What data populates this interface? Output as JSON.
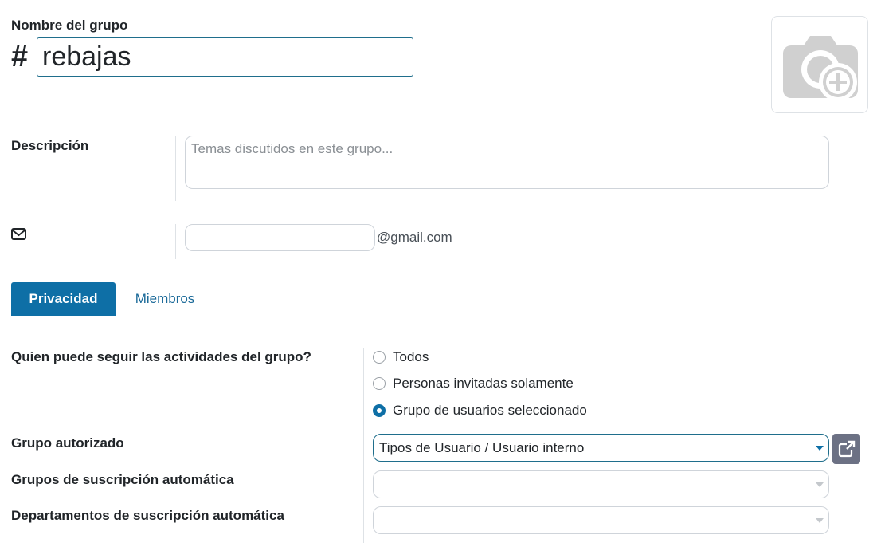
{
  "form": {
    "name_label": "Nombre del grupo",
    "name_prefix": "#",
    "name_value": "rebajas",
    "description_label": "Descripción",
    "description_placeholder": "Temas discutidos en este grupo...",
    "email_value": "",
    "email_suffix": "@gmail.com"
  },
  "icons": {
    "avatar": "camera-add-icon",
    "email": "envelope-icon",
    "external": "external-link-icon"
  },
  "tabs": [
    {
      "label": "Privacidad",
      "active": true
    },
    {
      "label": "Miembros",
      "active": false
    }
  ],
  "privacy": {
    "follow_label": "Quien puede seguir las actividades del grupo?",
    "options": [
      {
        "label": "Todos",
        "checked": false
      },
      {
        "label": "Personas invitadas solamente",
        "checked": false
      },
      {
        "label": "Grupo de usuarios seleccionado",
        "checked": true
      }
    ],
    "authorized_group_label": "Grupo autorizado",
    "authorized_group_value": "Tipos de Usuario / Usuario interno",
    "auto_sub_groups_label": "Grupos de suscripción automática",
    "auto_sub_groups_value": "",
    "auto_sub_depts_label": "Departamentos de suscripción automática",
    "auto_sub_depts_value": ""
  },
  "colors": {
    "primary": "#0e6fa6",
    "link": "#1b6a99",
    "muted_button": "#6c7184"
  }
}
